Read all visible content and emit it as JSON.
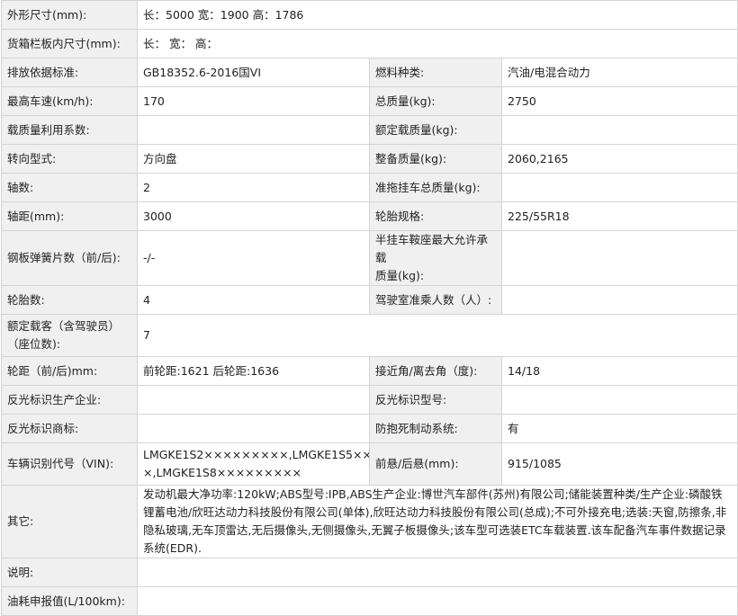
{
  "rows": [
    {
      "cols": [
        {
          "label": "外形尺寸(mm):",
          "value": "长：5000 宽：1900 高：1786",
          "span": true
        }
      ]
    },
    {
      "cols": [
        {
          "label": "货箱栏板内尺寸(mm):",
          "value": "长： 宽： 高：",
          "span": true
        }
      ]
    },
    {
      "cols": [
        {
          "label": "排放依据标准:",
          "value": "GB18352.6-2016国VI"
        },
        {
          "label": "燃料种类:",
          "value": "汽油/电混合动力"
        }
      ]
    },
    {
      "cols": [
        {
          "label": "最高车速(km/h):",
          "value": "170"
        },
        {
          "label": "总质量(kg):",
          "value": "2750"
        }
      ]
    },
    {
      "cols": [
        {
          "label": "载质量利用系数:",
          "value": ""
        },
        {
          "label": "额定载质量(kg):",
          "value": ""
        }
      ]
    },
    {
      "cols": [
        {
          "label": "转向型式:",
          "value": "方向盘"
        },
        {
          "label": "整备质量(kg):",
          "value": "2060,2165"
        }
      ]
    },
    {
      "cols": [
        {
          "label": "轴数:",
          "value": "2"
        },
        {
          "label": "准拖挂车总质量(kg):",
          "value": ""
        }
      ]
    },
    {
      "cols": [
        {
          "label": "轴距(mm):",
          "value": "3000"
        },
        {
          "label": "轮胎规格:",
          "value": "225/55R18"
        }
      ]
    },
    {
      "cols": [
        {
          "label": "钢板弹簧片数（前/后):",
          "value": "-/-"
        },
        {
          "label": "半挂车鞍座最大允许承载\n质量(kg):",
          "value": ""
        }
      ]
    },
    {
      "cols": [
        {
          "label": "轮胎数:",
          "value": "4"
        },
        {
          "label": "驾驶室准乘人数（人）:",
          "value": ""
        }
      ]
    },
    {
      "cols": [
        {
          "label": "额定载客（含驾驶员）\n（座位数):",
          "value": "7",
          "span": true
        }
      ]
    },
    {
      "cols": [
        {
          "label": "轮距（前/后)mm:",
          "value": "前轮距:1621 后轮距:1636"
        },
        {
          "label": "接近角/离去角（度):",
          "value": "14/18"
        }
      ]
    },
    {
      "cols": [
        {
          "label": "反光标识生产企业:",
          "value": ""
        },
        {
          "label": "反光标识型号:",
          "value": ""
        }
      ]
    },
    {
      "cols": [
        {
          "label": "反光标识商标:",
          "value": ""
        },
        {
          "label": "防抱死制动系统:",
          "value": "有"
        }
      ]
    },
    {
      "cols": [
        {
          "label": "车辆识别代号（VIN):",
          "value": "LMGKE1S2×××××××××,LMGKE1S5××××××××\n×,LMGKE1S8×××××××××"
        },
        {
          "label": "前悬/后悬(mm):",
          "value": "915/1085"
        }
      ]
    },
    {
      "cols": [
        {
          "label": "其它:",
          "value": "发动机最大净功率:120kW;ABS型号:IPB,ABS生产企业:博世汽车部件(苏州)有限公司;储能装置种类/生产企业:磷酸铁锂蓄电池/欣旺达动力科技股份有限公司(单体),欣旺达动力科技股份有限公司(总成);不可外接充电;选装:天窗,防擦条,非隐私玻璃,无车顶雷达,无后摄像头,无侧摄像头,无翼子板摄像头;该车型可选装ETC车载装置.该车配备汽车事件数据记录系统(EDR).",
          "span": true
        }
      ]
    },
    {
      "cols": [
        {
          "label": "说明:",
          "value": "",
          "span": true
        }
      ]
    },
    {
      "cols": [
        {
          "label": "油耗申报值(L/100km):",
          "value": "",
          "span": true
        }
      ]
    }
  ]
}
